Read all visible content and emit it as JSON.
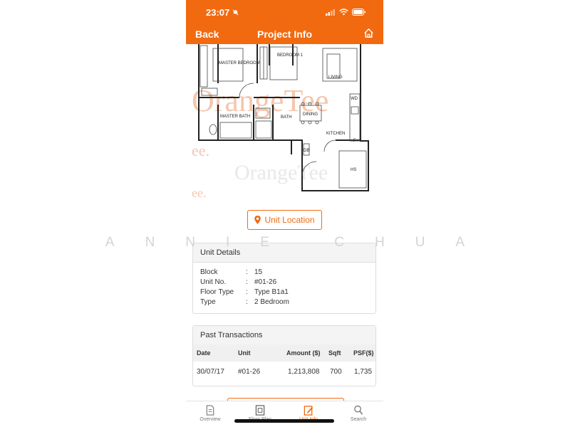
{
  "status": {
    "time": "23:07"
  },
  "header": {
    "back_label": "Back",
    "title": "Project Info"
  },
  "floorplan": {
    "rooms": [
      "MASTER BEDROOM",
      "BEDROOM 1",
      "LIVING",
      "MASTER BATH",
      "BATH",
      "DINING",
      "KITCHEN",
      "WD",
      "F",
      "DB",
      "HS"
    ],
    "watermark": "OrangeTee"
  },
  "unit_location_label": "Unit Location",
  "watermark_text": "ANNIE CHUA",
  "unit_details": {
    "heading": "Unit Details",
    "rows": [
      {
        "label": "Block",
        "value": "15"
      },
      {
        "label": "Unit No.",
        "value": "#01-26"
      },
      {
        "label": "Floor Type",
        "value": "Type B1a1"
      },
      {
        "label": "Type",
        "value": "2 Bedroom"
      }
    ]
  },
  "past_transactions": {
    "heading": "Past Transactions",
    "columns": [
      "Date",
      "Unit",
      "Amount ($)",
      "Sqft",
      "PSF($)"
    ],
    "rows": [
      [
        "30/07/17",
        "#01-26",
        "1,213,808",
        "700",
        "1,735"
      ]
    ]
  },
  "tabs": [
    {
      "label": "Overview",
      "active": false
    },
    {
      "label": "Floor Plan",
      "active": false
    },
    {
      "label": "Unit Info",
      "active": true
    },
    {
      "label": "Search",
      "active": false
    }
  ],
  "colors": {
    "accent": "#f26a10",
    "header_text": "#ffffff"
  }
}
